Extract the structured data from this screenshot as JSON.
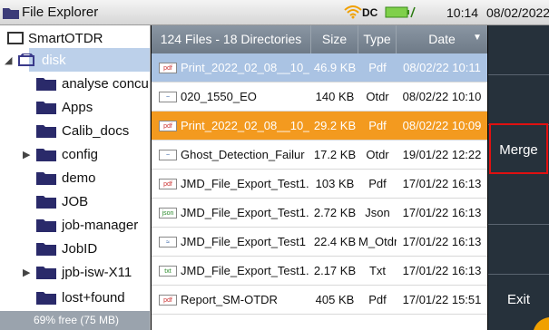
{
  "titlebar": {
    "title": "File Explorer",
    "power_label": "DC",
    "time": "10:14",
    "date": "08/02/2022"
  },
  "tree": {
    "root": "SmartOTDR",
    "disk": "disk",
    "folders": [
      {
        "label": "analyse concu",
        "expandable": false
      },
      {
        "label": "Apps",
        "expandable": false
      },
      {
        "label": "Calib_docs",
        "expandable": false
      },
      {
        "label": "config",
        "expandable": true
      },
      {
        "label": "demo",
        "expandable": false
      },
      {
        "label": "JOB",
        "expandable": false
      },
      {
        "label": "job-manager",
        "expandable": false
      },
      {
        "label": "JobID",
        "expandable": false
      },
      {
        "label": "jpb-isw-X11",
        "expandable": true
      },
      {
        "label": "lost+found",
        "expandable": false
      }
    ],
    "free_space": "69% free (75 MB)"
  },
  "list": {
    "header": {
      "summary": "124 Files - 18 Directories",
      "size": "Size",
      "type": "Type",
      "date": "Date"
    },
    "rows": [
      {
        "icon": "pdf",
        "name": "Print_2022_02_08__10_",
        "size": "46.9 KB",
        "type": "Pdf",
        "date": "08/02/22 10:11",
        "state": "selected-blue"
      },
      {
        "icon": "otdr",
        "name": "020_1550_EO",
        "size": "140 KB",
        "type": "Otdr",
        "date": "08/02/22 10:10",
        "state": "normal"
      },
      {
        "icon": "pdf",
        "name": "Print_2022_02_08__10_",
        "size": "29.2 KB",
        "type": "Pdf",
        "date": "08/02/22 10:09",
        "state": "selected-orange"
      },
      {
        "icon": "otdr",
        "name": "Ghost_Detection_Failur",
        "size": "17.2 KB",
        "type": "Otdr",
        "date": "19/01/22 12:22",
        "state": "normal"
      },
      {
        "icon": "pdf",
        "name": "JMD_File_Export_Test1.",
        "size": "103 KB",
        "type": "Pdf",
        "date": "17/01/22 16:13",
        "state": "normal"
      },
      {
        "icon": "json",
        "name": "JMD_File_Export_Test1.",
        "size": "2.72 KB",
        "type": "Json",
        "date": "17/01/22 16:13",
        "state": "normal"
      },
      {
        "icon": "motdr",
        "name": "JMD_File_Export_Test1",
        "size": "22.4 KB",
        "type": "M_Otdr",
        "date": "17/01/22 16:13",
        "state": "normal"
      },
      {
        "icon": "txt",
        "name": "JMD_File_Export_Test1.",
        "size": "2.17 KB",
        "type": "Txt",
        "date": "17/01/22 16:13",
        "state": "normal"
      },
      {
        "icon": "pdf",
        "name": "Report_SM-OTDR",
        "size": "405 KB",
        "type": "Pdf",
        "date": "17/01/22 15:51",
        "state": "normal"
      }
    ]
  },
  "side": {
    "merge": "Merge",
    "exit": "Exit"
  },
  "colors": {
    "accent_orange": "#f39a1f",
    "selected_blue": "#aac3e3",
    "side_panel": "#26313b",
    "highlight_border": "#e01010"
  }
}
